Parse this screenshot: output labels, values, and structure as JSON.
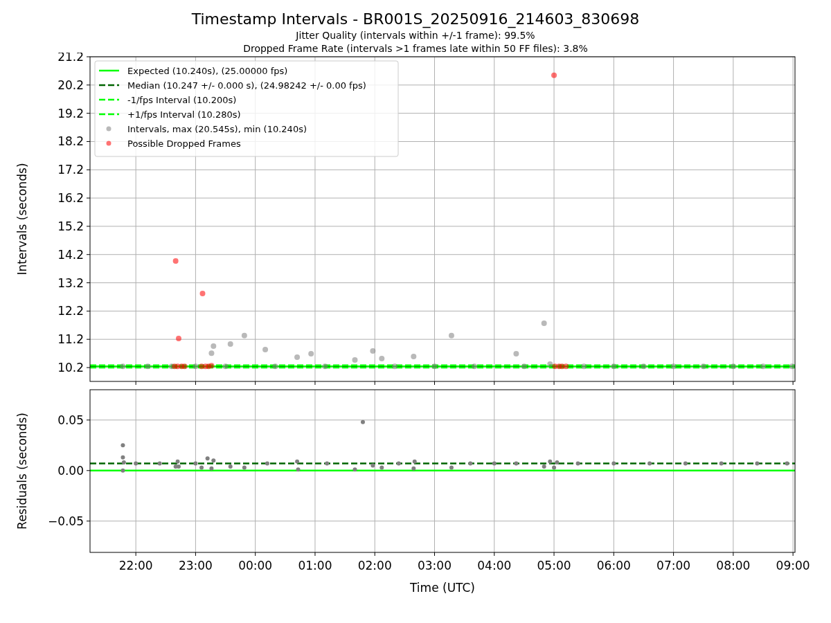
{
  "figure": {
    "title": "Timestamp Intervals - BR001S_20250916_214603_830698",
    "subtitles": [
      "Jitter Quality (intervals within +/-1 frame): 99.5%",
      "Dropped Frame Rate (intervals >1 frames late within 50 FF files): 3.8%"
    ]
  },
  "upper_chart": {
    "chart_data": {
      "type": "scatter",
      "grid": true,
      "legend": true,
      "ylabel": "Intervals (seconds)",
      "xlim": [
        "2025-09-16T21:14Z",
        "2025-09-17T09:02Z"
      ],
      "ylim": [
        9.71,
        21.2
      ],
      "yticks": [
        {
          "value": 10.2,
          "label": "10.2"
        },
        {
          "value": 11.2,
          "label": "11.2"
        },
        {
          "value": 12.2,
          "label": "12.2"
        },
        {
          "value": 13.2,
          "label": "13.2"
        },
        {
          "value": 14.2,
          "label": "14.2"
        },
        {
          "value": 15.2,
          "label": "15.2"
        },
        {
          "value": 16.2,
          "label": "16.2"
        },
        {
          "value": 17.2,
          "label": "17.2"
        },
        {
          "value": 18.2,
          "label": "18.2"
        },
        {
          "value": 19.2,
          "label": "19.2"
        },
        {
          "value": 20.2,
          "label": "20.2"
        },
        {
          "value": 21.2,
          "label": "21.2"
        }
      ],
      "series": [
        {
          "name": "Expected (10.240s), (25.00000 fps)",
          "type": "line",
          "color": "#00ff00",
          "x": [
            "2025-09-16T21:14Z",
            "2025-09-17T09:02Z"
          ],
          "values": [
            10.24,
            10.24
          ]
        },
        {
          "name": "Median (10.247 +/- 0.000 s), (24.98242 +/- 0.00 fps)",
          "type": "line",
          "line_style": "dashed",
          "color": "#006400",
          "x": [
            "2025-09-16T21:14Z",
            "2025-09-17T09:02Z"
          ],
          "values": [
            10.247,
            10.247
          ]
        },
        {
          "name": "-1/fps Interval (10.200s)",
          "type": "line",
          "line_style": "dashed",
          "color": "#00ff00",
          "x": [
            "2025-09-16T21:14Z",
            "2025-09-17T09:02Z"
          ],
          "values": [
            10.2,
            10.2
          ]
        },
        {
          "name": "+1/fps Interval (10.280s)",
          "type": "line",
          "line_style": "dashed",
          "color": "#00ff00",
          "x": [
            "2025-09-16T21:14Z",
            "2025-09-17T09:02Z"
          ],
          "values": [
            10.28,
            10.28
          ]
        },
        {
          "name": "Intervals, max (20.545s), min (10.240s)",
          "type": "scatter",
          "color": "#808080",
          "x": [
            "2025-09-16T21:47Z",
            "2025-09-16T22:12Z",
            "2025-09-16T22:36Z",
            "2025-09-16T23:00Z",
            "2025-09-16T23:16Z",
            "2025-09-16T23:18Z",
            "2025-09-16T23:35Z",
            "2025-09-16T23:49Z",
            "2025-09-17T00:10Z",
            "2025-09-17T00:42Z",
            "2025-09-17T00:56Z",
            "2025-09-17T01:40Z",
            "2025-09-17T01:58Z",
            "2025-09-17T02:07Z",
            "2025-09-17T02:39Z",
            "2025-09-17T03:17Z",
            "2025-09-17T04:22Z",
            "2025-09-17T04:50Z",
            "2025-09-17T04:56Z",
            "2025-09-16T23:30Z",
            "2025-09-17T00:20Z",
            "2025-09-17T01:10Z",
            "2025-09-17T02:20Z",
            "2025-09-17T03:00Z",
            "2025-09-17T03:40Z",
            "2025-09-17T04:30Z",
            "2025-09-17T05:30Z",
            "2025-09-17T06:00Z",
            "2025-09-17T06:30Z",
            "2025-09-17T07:00Z",
            "2025-09-17T07:30Z",
            "2025-09-17T08:00Z",
            "2025-09-17T08:30Z",
            "2025-09-17T08:59Z"
          ],
          "values": [
            10.24,
            10.24,
            10.24,
            10.24,
            10.71,
            10.96,
            11.03,
            11.33,
            10.84,
            10.57,
            10.69,
            10.47,
            10.79,
            10.52,
            10.59,
            11.33,
            10.69,
            11.77,
            10.32,
            10.24,
            10.24,
            10.24,
            10.24,
            10.24,
            10.24,
            10.24,
            10.24,
            10.24,
            10.24,
            10.24,
            10.24,
            10.24,
            10.24,
            10.24
          ]
        },
        {
          "name": "Possible Dropped Frames",
          "type": "scatter",
          "color": "#ff0000",
          "x": [
            "2025-09-16T22:40Z",
            "2025-09-16T22:43Z",
            "2025-09-16T23:07Z",
            "2025-09-17T05:00Z",
            "2025-09-16T22:39Z",
            "2025-09-16T22:42Z",
            "2025-09-16T22:46Z",
            "2025-09-16T22:49Z",
            "2025-09-16T23:06Z",
            "2025-09-16T23:10Z",
            "2025-09-16T23:13Z",
            "2025-09-16T23:16Z",
            "2025-09-17T05:01Z",
            "2025-09-17T05:05Z",
            "2025-09-17T05:08Z",
            "2025-09-17T05:12Z"
          ],
          "values": [
            13.97,
            11.23,
            12.82,
            20.545,
            10.24,
            10.24,
            10.24,
            10.24,
            10.24,
            10.24,
            10.24,
            10.27,
            10.24,
            10.24,
            10.24,
            10.24
          ]
        }
      ]
    }
  },
  "lower_chart": {
    "chart_data": {
      "type": "scatter",
      "grid": true,
      "xlabel": "Time (UTC)",
      "ylabel": "Residuals (seconds)",
      "xlim": [
        "2025-09-16T21:14Z",
        "2025-09-17T09:02Z"
      ],
      "ylim": [
        -0.081,
        0.08
      ],
      "xticks": [
        {
          "value": "2025-09-16T22:00Z",
          "label": "22:00"
        },
        {
          "value": "2025-09-16T23:00Z",
          "label": "23:00"
        },
        {
          "value": "2025-09-17T00:00Z",
          "label": "00:00"
        },
        {
          "value": "2025-09-17T01:00Z",
          "label": "01:00"
        },
        {
          "value": "2025-09-17T02:00Z",
          "label": "02:00"
        },
        {
          "value": "2025-09-17T03:00Z",
          "label": "03:00"
        },
        {
          "value": "2025-09-17T04:00Z",
          "label": "04:00"
        },
        {
          "value": "2025-09-17T05:00Z",
          "label": "05:00"
        },
        {
          "value": "2025-09-17T06:00Z",
          "label": "06:00"
        },
        {
          "value": "2025-09-17T07:00Z",
          "label": "07:00"
        },
        {
          "value": "2025-09-17T08:00Z",
          "label": "08:00"
        },
        {
          "value": "2025-09-17T09:00Z",
          "label": "09:00"
        }
      ],
      "yticks": [
        {
          "value": 0.05,
          "label": "0.05"
        },
        {
          "value": 0,
          "label": "0.00"
        },
        {
          "value": -0.05,
          "label": "−0.05"
        }
      ],
      "series": [
        {
          "type": "line",
          "color": "#00ff00",
          "x": [
            "2025-09-16T21:14Z",
            "2025-09-17T09:02Z"
          ],
          "values": [
            0,
            0
          ]
        },
        {
          "type": "line",
          "line_style": "dashed",
          "color": "#006400",
          "x": [
            "2025-09-16T21:14Z",
            "2025-09-17T09:02Z"
          ],
          "values": [
            0.007,
            0.007
          ]
        },
        {
          "type": "scatter",
          "color": "#808080",
          "x": [
            "2025-09-16T21:47Z",
            "2025-09-16T21:47Z",
            "2025-09-16T21:47Z",
            "2025-09-16T21:48Z",
            "2025-09-16T22:40Z",
            "2025-09-16T22:42Z",
            "2025-09-16T22:43Z",
            "2025-09-16T23:06Z",
            "2025-09-16T23:12Z",
            "2025-09-16T23:16Z",
            "2025-09-16T23:18Z",
            "2025-09-16T23:35Z",
            "2025-09-16T23:49Z",
            "2025-09-17T00:42Z",
            "2025-09-17T00:43Z",
            "2025-09-17T01:40Z",
            "2025-09-17T01:48Z",
            "2025-09-17T01:58Z",
            "2025-09-17T02:07Z",
            "2025-09-17T02:39Z",
            "2025-09-17T02:40Z",
            "2025-09-17T03:17Z",
            "2025-09-17T04:22Z",
            "2025-09-17T04:50Z",
            "2025-09-17T04:56Z",
            "2025-09-17T05:00Z",
            "2025-09-17T05:03Z",
            "2025-09-16T22:00Z",
            "2025-09-16T22:24Z",
            "2025-09-16T23:00Z",
            "2025-09-17T00:12Z",
            "2025-09-17T01:12Z",
            "2025-09-17T02:24Z",
            "2025-09-17T03:36Z",
            "2025-09-17T04:00Z",
            "2025-09-17T05:24Z",
            "2025-09-17T06:00Z",
            "2025-09-17T06:36Z",
            "2025-09-17T07:12Z",
            "2025-09-17T07:48Z",
            "2025-09-17T08:24Z",
            "2025-09-17T08:54Z"
          ],
          "values": [
            0.025,
            0.013,
            0.0,
            0.008,
            0.004,
            0.009,
            0.004,
            0.003,
            0.012,
            0.002,
            0.01,
            0.004,
            0.003,
            0.009,
            0.001,
            0.001,
            0.048,
            0.005,
            0.003,
            0.002,
            0.009,
            0.003,
            0.007,
            0.004,
            0.009,
            0.003,
            0.008,
            0.007,
            0.007,
            0.007,
            0.007,
            0.007,
            0.007,
            0.007,
            0.007,
            0.007,
            0.007,
            0.007,
            0.007,
            0.007,
            0.007,
            0.007
          ]
        }
      ]
    }
  }
}
